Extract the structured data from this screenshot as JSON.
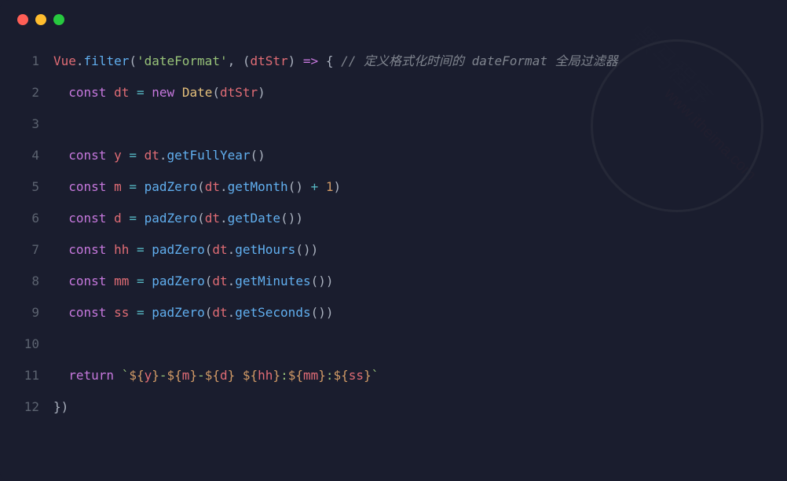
{
  "lines": [
    {
      "num": "1",
      "indent": "",
      "tokens": [
        {
          "c": "tok-red",
          "t": "Vue"
        },
        {
          "c": "tok-white",
          "t": "."
        },
        {
          "c": "tok-blue",
          "t": "filter"
        },
        {
          "c": "tok-white",
          "t": "("
        },
        {
          "c": "tok-green",
          "t": "'dateFormat'"
        },
        {
          "c": "tok-white",
          "t": ", ("
        },
        {
          "c": "tok-red",
          "t": "dtStr"
        },
        {
          "c": "tok-white",
          "t": ") "
        },
        {
          "c": "tok-purple",
          "t": "=>"
        },
        {
          "c": "tok-white",
          "t": " { "
        },
        {
          "c": "tok-comment",
          "t": "// 定义格式化时间的 dateFormat 全局过滤器"
        }
      ]
    },
    {
      "num": "2",
      "indent": "  ",
      "tokens": [
        {
          "c": "tok-purple",
          "t": "const"
        },
        {
          "c": "tok-white",
          "t": " "
        },
        {
          "c": "tok-red",
          "t": "dt"
        },
        {
          "c": "tok-white",
          "t": " "
        },
        {
          "c": "tok-cyan",
          "t": "="
        },
        {
          "c": "tok-white",
          "t": " "
        },
        {
          "c": "tok-purple",
          "t": "new"
        },
        {
          "c": "tok-white",
          "t": " "
        },
        {
          "c": "tok-yellow",
          "t": "Date"
        },
        {
          "c": "tok-white",
          "t": "("
        },
        {
          "c": "tok-red",
          "t": "dtStr"
        },
        {
          "c": "tok-white",
          "t": ")"
        }
      ]
    },
    {
      "num": "3",
      "indent": "",
      "tokens": []
    },
    {
      "num": "4",
      "indent": "  ",
      "tokens": [
        {
          "c": "tok-purple",
          "t": "const"
        },
        {
          "c": "tok-white",
          "t": " "
        },
        {
          "c": "tok-red",
          "t": "y"
        },
        {
          "c": "tok-white",
          "t": " "
        },
        {
          "c": "tok-cyan",
          "t": "="
        },
        {
          "c": "tok-white",
          "t": " "
        },
        {
          "c": "tok-red",
          "t": "dt"
        },
        {
          "c": "tok-white",
          "t": "."
        },
        {
          "c": "tok-blue",
          "t": "getFullYear"
        },
        {
          "c": "tok-white",
          "t": "()"
        }
      ]
    },
    {
      "num": "5",
      "indent": "  ",
      "tokens": [
        {
          "c": "tok-purple",
          "t": "const"
        },
        {
          "c": "tok-white",
          "t": " "
        },
        {
          "c": "tok-red",
          "t": "m"
        },
        {
          "c": "tok-white",
          "t": " "
        },
        {
          "c": "tok-cyan",
          "t": "="
        },
        {
          "c": "tok-white",
          "t": " "
        },
        {
          "c": "tok-blue",
          "t": "padZero"
        },
        {
          "c": "tok-white",
          "t": "("
        },
        {
          "c": "tok-red",
          "t": "dt"
        },
        {
          "c": "tok-white",
          "t": "."
        },
        {
          "c": "tok-blue",
          "t": "getMonth"
        },
        {
          "c": "tok-white",
          "t": "() "
        },
        {
          "c": "tok-cyan",
          "t": "+"
        },
        {
          "c": "tok-white",
          "t": " "
        },
        {
          "c": "tok-orange",
          "t": "1"
        },
        {
          "c": "tok-white",
          "t": ")"
        }
      ]
    },
    {
      "num": "6",
      "indent": "  ",
      "tokens": [
        {
          "c": "tok-purple",
          "t": "const"
        },
        {
          "c": "tok-white",
          "t": " "
        },
        {
          "c": "tok-red",
          "t": "d"
        },
        {
          "c": "tok-white",
          "t": " "
        },
        {
          "c": "tok-cyan",
          "t": "="
        },
        {
          "c": "tok-white",
          "t": " "
        },
        {
          "c": "tok-blue",
          "t": "padZero"
        },
        {
          "c": "tok-white",
          "t": "("
        },
        {
          "c": "tok-red",
          "t": "dt"
        },
        {
          "c": "tok-white",
          "t": "."
        },
        {
          "c": "tok-blue",
          "t": "getDate"
        },
        {
          "c": "tok-white",
          "t": "())"
        }
      ]
    },
    {
      "num": "7",
      "indent": "  ",
      "tokens": [
        {
          "c": "tok-purple",
          "t": "const"
        },
        {
          "c": "tok-white",
          "t": " "
        },
        {
          "c": "tok-red",
          "t": "hh"
        },
        {
          "c": "tok-white",
          "t": " "
        },
        {
          "c": "tok-cyan",
          "t": "="
        },
        {
          "c": "tok-white",
          "t": " "
        },
        {
          "c": "tok-blue",
          "t": "padZero"
        },
        {
          "c": "tok-white",
          "t": "("
        },
        {
          "c": "tok-red",
          "t": "dt"
        },
        {
          "c": "tok-white",
          "t": "."
        },
        {
          "c": "tok-blue",
          "t": "getHours"
        },
        {
          "c": "tok-white",
          "t": "())"
        }
      ]
    },
    {
      "num": "8",
      "indent": "  ",
      "tokens": [
        {
          "c": "tok-purple",
          "t": "const"
        },
        {
          "c": "tok-white",
          "t": " "
        },
        {
          "c": "tok-red",
          "t": "mm"
        },
        {
          "c": "tok-white",
          "t": " "
        },
        {
          "c": "tok-cyan",
          "t": "="
        },
        {
          "c": "tok-white",
          "t": " "
        },
        {
          "c": "tok-blue",
          "t": "padZero"
        },
        {
          "c": "tok-white",
          "t": "("
        },
        {
          "c": "tok-red",
          "t": "dt"
        },
        {
          "c": "tok-white",
          "t": "."
        },
        {
          "c": "tok-blue",
          "t": "getMinutes"
        },
        {
          "c": "tok-white",
          "t": "())"
        }
      ]
    },
    {
      "num": "9",
      "indent": "  ",
      "tokens": [
        {
          "c": "tok-purple",
          "t": "const"
        },
        {
          "c": "tok-white",
          "t": " "
        },
        {
          "c": "tok-red",
          "t": "ss"
        },
        {
          "c": "tok-white",
          "t": " "
        },
        {
          "c": "tok-cyan",
          "t": "="
        },
        {
          "c": "tok-white",
          "t": " "
        },
        {
          "c": "tok-blue",
          "t": "padZero"
        },
        {
          "c": "tok-white",
          "t": "("
        },
        {
          "c": "tok-red",
          "t": "dt"
        },
        {
          "c": "tok-white",
          "t": "."
        },
        {
          "c": "tok-blue",
          "t": "getSeconds"
        },
        {
          "c": "tok-white",
          "t": "())"
        }
      ]
    },
    {
      "num": "10",
      "indent": "",
      "tokens": []
    },
    {
      "num": "11",
      "indent": "  ",
      "tokens": [
        {
          "c": "tok-purple",
          "t": "return"
        },
        {
          "c": "tok-white",
          "t": " "
        },
        {
          "c": "tok-green",
          "t": "`"
        },
        {
          "c": "tok-orange",
          "t": "${"
        },
        {
          "c": "tok-red",
          "t": "y"
        },
        {
          "c": "tok-orange",
          "t": "}"
        },
        {
          "c": "tok-green",
          "t": "-"
        },
        {
          "c": "tok-orange",
          "t": "${"
        },
        {
          "c": "tok-red",
          "t": "m"
        },
        {
          "c": "tok-orange",
          "t": "}"
        },
        {
          "c": "tok-green",
          "t": "-"
        },
        {
          "c": "tok-orange",
          "t": "${"
        },
        {
          "c": "tok-red",
          "t": "d"
        },
        {
          "c": "tok-orange",
          "t": "}"
        },
        {
          "c": "tok-green",
          "t": " "
        },
        {
          "c": "tok-orange",
          "t": "${"
        },
        {
          "c": "tok-red",
          "t": "hh"
        },
        {
          "c": "tok-orange",
          "t": "}"
        },
        {
          "c": "tok-green",
          "t": ":"
        },
        {
          "c": "tok-orange",
          "t": "${"
        },
        {
          "c": "tok-red",
          "t": "mm"
        },
        {
          "c": "tok-orange",
          "t": "}"
        },
        {
          "c": "tok-green",
          "t": ":"
        },
        {
          "c": "tok-orange",
          "t": "${"
        },
        {
          "c": "tok-red",
          "t": "ss"
        },
        {
          "c": "tok-orange",
          "t": "}"
        },
        {
          "c": "tok-green",
          "t": "`"
        }
      ]
    },
    {
      "num": "12",
      "indent": "",
      "tokens": [
        {
          "c": "tok-white",
          "t": "})"
        }
      ]
    }
  ],
  "watermark": {
    "cn": "黑马程序",
    "url": "www.itheima.com"
  }
}
